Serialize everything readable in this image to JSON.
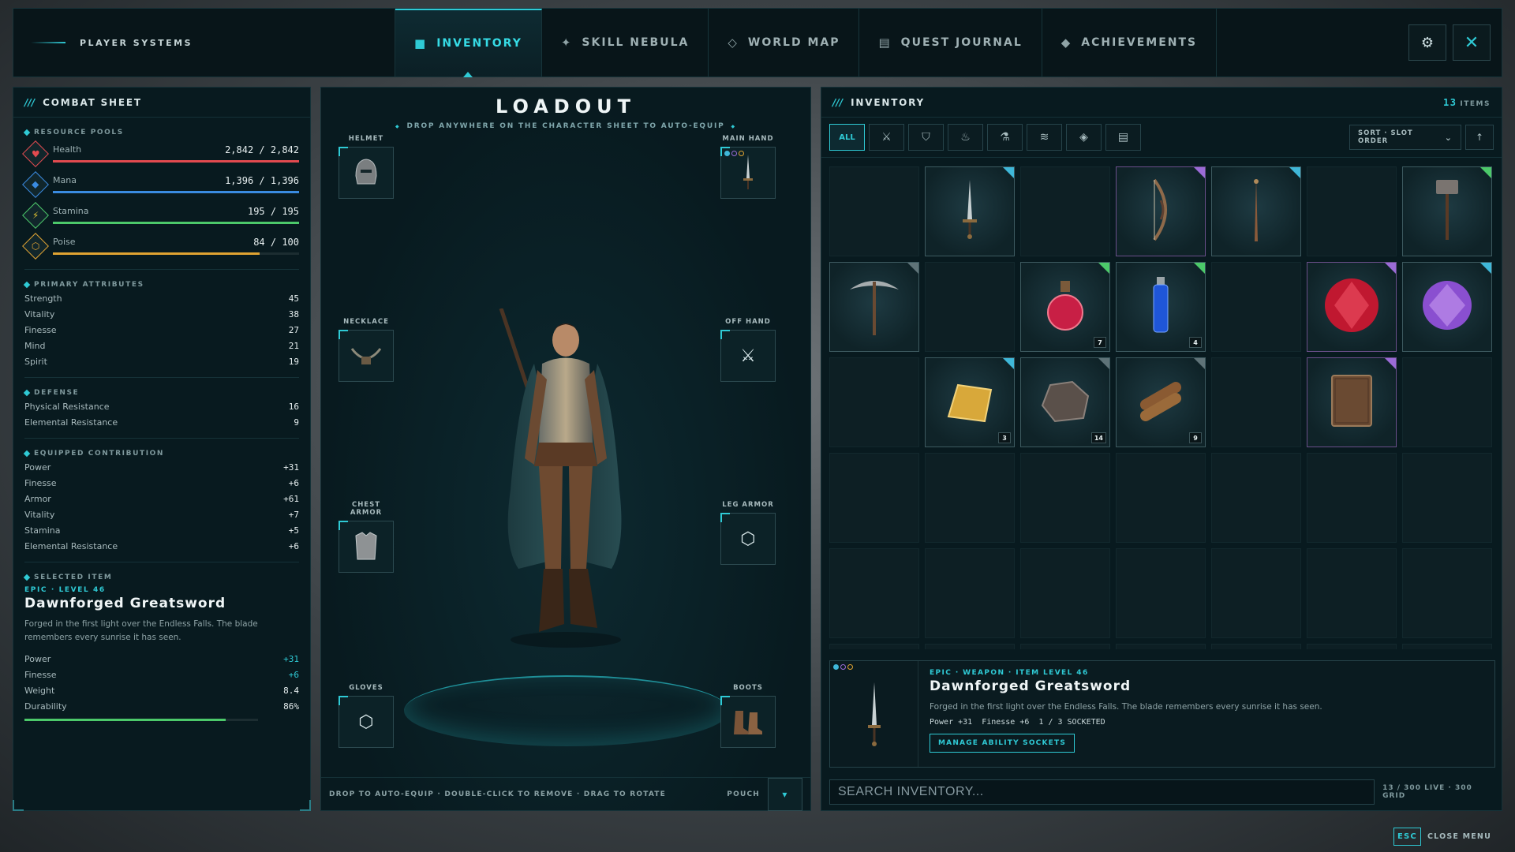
{
  "topbar": {
    "brand": "PLAYER SYSTEMS",
    "tabs": [
      {
        "label": "INVENTORY",
        "icon": "inventory-square-icon",
        "active": true
      },
      {
        "label": "SKILL NEBULA",
        "icon": "star-sparkle-icon",
        "active": false
      },
      {
        "label": "WORLD MAP",
        "icon": "diamond-outline-icon",
        "active": false
      },
      {
        "label": "QUEST JOURNAL",
        "icon": "journal-icon",
        "active": false
      },
      {
        "label": "ACHIEVEMENTS",
        "icon": "diamond-filled-icon",
        "active": false
      }
    ],
    "settings_icon": "gear-icon",
    "close_icon": "close-x-icon"
  },
  "combat_sheet": {
    "title": "COMBAT SHEET",
    "resource_pools_label": "RESOURCE POOLS",
    "resources": [
      {
        "name": "Health",
        "value": "2,842 / 2,842",
        "fill": 1.0,
        "color": "#e24a4f",
        "icon": "heart-icon"
      },
      {
        "name": "Mana",
        "value": "1,396 / 1,396",
        "fill": 1.0,
        "color": "#3a8be0",
        "icon": "mana-diamond-icon"
      },
      {
        "name": "Stamina",
        "value": "195 / 195",
        "fill": 1.0,
        "color": "#4cc96a",
        "icon": "lightning-icon"
      },
      {
        "name": "Poise",
        "value": "84 / 100",
        "fill": 0.84,
        "color": "#e0a332",
        "icon": "hexagon-icon"
      }
    ],
    "primary_attributes_label": "PRIMARY ATTRIBUTES",
    "primary_attributes": [
      {
        "name": "Strength",
        "value": "45"
      },
      {
        "name": "Vitality",
        "value": "38"
      },
      {
        "name": "Finesse",
        "value": "27"
      },
      {
        "name": "Mind",
        "value": "21"
      },
      {
        "name": "Spirit",
        "value": "19"
      }
    ],
    "defense_label": "DEFENSE",
    "defense": [
      {
        "name": "Physical Resistance",
        "value": "16"
      },
      {
        "name": "Elemental Resistance",
        "value": "9"
      }
    ],
    "equipped_label": "EQUIPPED CONTRIBUTION",
    "equipped": [
      {
        "name": "Power",
        "value": "+31"
      },
      {
        "name": "Finesse",
        "value": "+6"
      },
      {
        "name": "Armor",
        "value": "+61"
      },
      {
        "name": "Vitality",
        "value": "+7"
      },
      {
        "name": "Stamina",
        "value": "+5"
      },
      {
        "name": "Elemental Resistance",
        "value": "+6"
      }
    ],
    "selected_label": "SELECTED ITEM",
    "selected": {
      "rarity": "EPIC · LEVEL 46",
      "name": "Dawnforged Greatsword",
      "description": "Forged in the first light over the Endless Falls. The blade remembers every sunrise it has seen.",
      "stats": [
        {
          "name": "Power",
          "value": "+31"
        },
        {
          "name": "Finesse",
          "value": "+6"
        },
        {
          "name": "Weight",
          "value": "8.4"
        },
        {
          "name": "Durability",
          "value": "86%"
        }
      ],
      "durability": 0.86
    }
  },
  "loadout": {
    "title": "LOADOUT",
    "subtitle": "DROP ANYWHERE ON THE CHARACTER SHEET TO AUTO-EQUIP",
    "slots": {
      "helmet": {
        "label": "HELMET",
        "icon": "helmet-icon"
      },
      "main_hand": {
        "label": "MAIN HAND",
        "icon": "greatsword-icon"
      },
      "necklace": {
        "label": "NECKLACE",
        "icon": "necklace-icon"
      },
      "off_hand": {
        "label": "OFF HAND",
        "icon": "crossed-swords-empty-icon"
      },
      "chest": {
        "label": "CHEST ARMOR",
        "icon": "chest-armor-icon"
      },
      "leg": {
        "label": "LEG ARMOR",
        "icon": "hexagon-empty-icon"
      },
      "gloves": {
        "label": "GLOVES",
        "icon": "hexagon-empty-icon"
      },
      "boots": {
        "label": "BOOTS",
        "icon": "boots-icon"
      }
    },
    "footer_hint": "DROP TO AUTO-EQUIP · DOUBLE-CLICK TO REMOVE · DRAG TO ROTATE",
    "pouch_label": "POUCH",
    "pouch_icon": "chevron-down-icon"
  },
  "inventory": {
    "title": "INVENTORY",
    "item_count": "13",
    "items_label": "ITEMS",
    "filters": [
      {
        "label": "ALL",
        "icon": "",
        "active": true
      },
      {
        "label": "",
        "icon": "crossed-swords-icon"
      },
      {
        "label": "",
        "icon": "shield-icon"
      },
      {
        "label": "",
        "icon": "flame-icon"
      },
      {
        "label": "",
        "icon": "potion-flask-icon"
      },
      {
        "label": "",
        "icon": "materials-icon"
      },
      {
        "label": "",
        "icon": "gem-icon"
      },
      {
        "label": "",
        "icon": "scroll-icon"
      }
    ],
    "sort_label": "SORT · SLOT ORDER",
    "sort_dir_icon": "arrow-up-icon",
    "cells": [
      {
        "item": null
      },
      {
        "item": {
          "name": "greatsword",
          "icon": "greatsword-icon",
          "rarity": "#3fb7d8",
          "count": ""
        }
      },
      {
        "item": null
      },
      {
        "item": {
          "name": "bow",
          "icon": "bow-icon",
          "rarity": "#9b6bd6",
          "count": ""
        }
      },
      {
        "item": {
          "name": "staff",
          "icon": "staff-icon",
          "rarity": "#3fb7d8",
          "count": ""
        }
      },
      {
        "item": null
      },
      {
        "item": {
          "name": "hammer",
          "icon": "hammer-icon",
          "rarity": "#4cc96a",
          "count": ""
        }
      },
      {
        "item": {
          "name": "pickaxe",
          "icon": "pickaxe-icon",
          "rarity": "#5f7378",
          "count": ""
        }
      },
      {
        "item": null
      },
      {
        "item": {
          "name": "health potion",
          "icon": "red-potion-icon",
          "rarity": "#4cc96a",
          "count": "7"
        }
      },
      {
        "item": {
          "name": "mana vial",
          "icon": "blue-vial-icon",
          "rarity": "#4cc96a",
          "count": "4"
        }
      },
      {
        "item": null
      },
      {
        "item": {
          "name": "ruby",
          "icon": "ruby-icon",
          "rarity": "#9b6bd6",
          "count": ""
        }
      },
      {
        "item": {
          "name": "amethyst",
          "icon": "amethyst-icon",
          "rarity": "#3fb7d8",
          "count": ""
        }
      },
      {
        "item": null
      },
      {
        "item": {
          "name": "gold ingot",
          "icon": "gold-ingot-icon",
          "rarity": "#3fb7d8",
          "count": "3"
        }
      },
      {
        "item": {
          "name": "ore",
          "icon": "ore-icon",
          "rarity": "#5f7378",
          "count": "14"
        }
      },
      {
        "item": {
          "name": "wood logs",
          "icon": "wood-logs-icon",
          "rarity": "#5f7378",
          "count": "9"
        }
      },
      {
        "item": null
      },
      {
        "item": {
          "name": "tome",
          "icon": "tome-icon",
          "rarity": "#9b6bd6",
          "count": ""
        }
      },
      {
        "item": null
      }
    ],
    "detail": {
      "meta": "EPIC · WEAPON · ITEM LEVEL 46",
      "name": "Dawnforged Greatsword",
      "description": "Forged in the first light over the Endless Falls. The blade remembers every sunrise it has seen.",
      "stat_power": "Power +31",
      "stat_finesse": "Finesse +6",
      "sockets": "1 / 3 SOCKETED",
      "button": "MANAGE ABILITY SOCKETS",
      "socket_colors": [
        "#3fb7d8",
        "#9b6bd6",
        "#e0a332"
      ]
    },
    "search_placeholder": "SEARCH INVENTORY...",
    "capacity": "13 / 300 LIVE · 300 GRID"
  },
  "footer": {
    "key": "ESC",
    "label": "CLOSE MENU"
  }
}
